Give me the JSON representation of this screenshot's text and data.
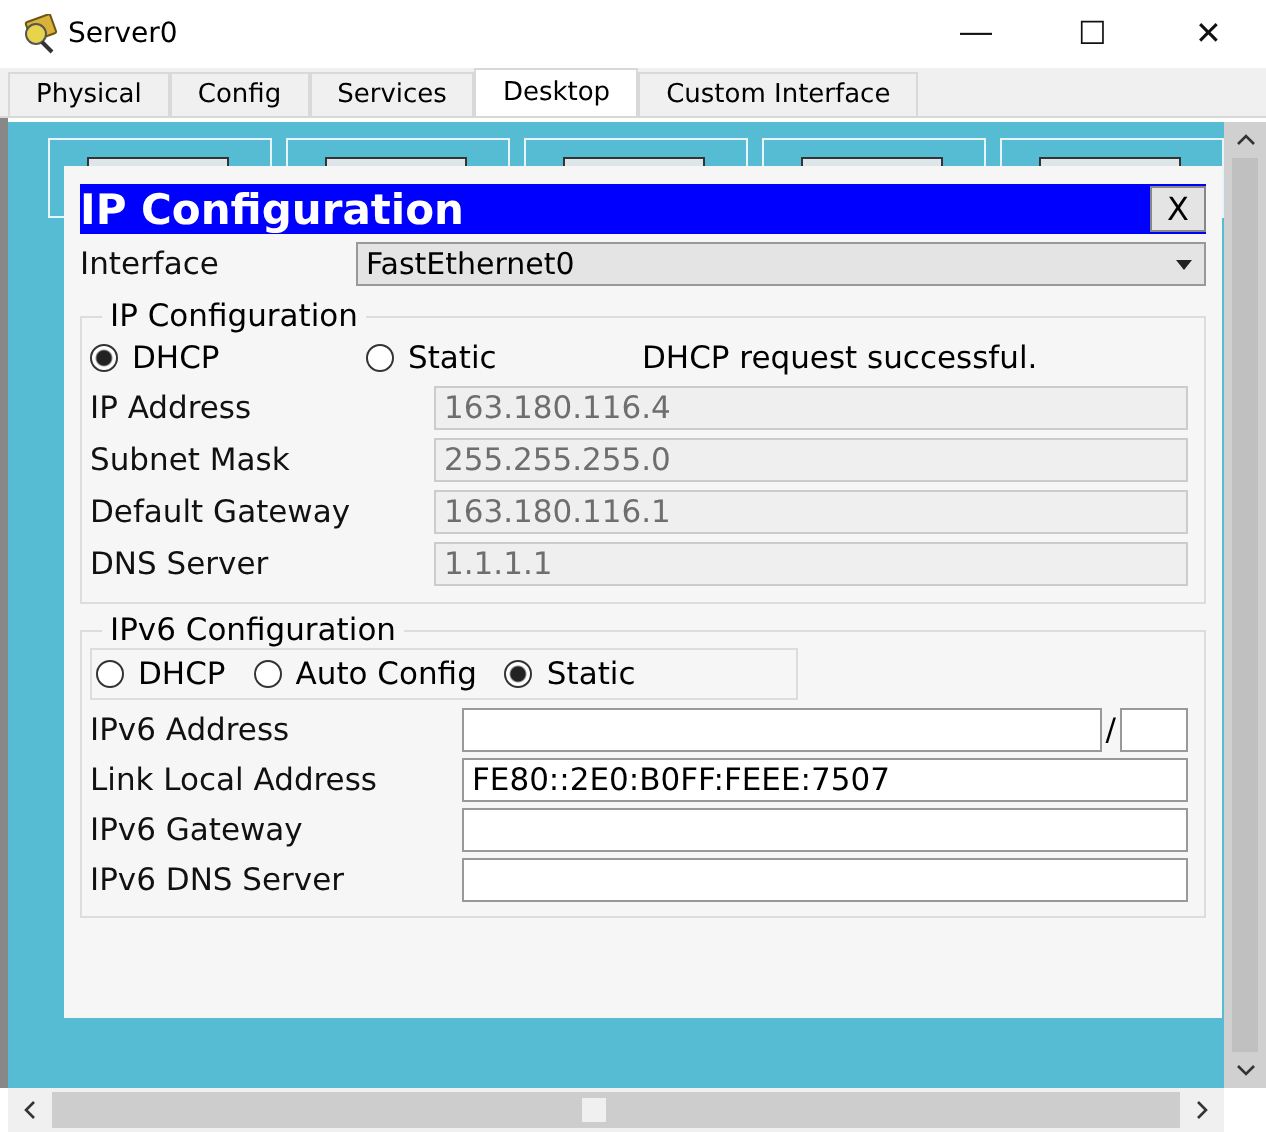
{
  "window": {
    "title": "Server0",
    "controls": [
      "—",
      "☐",
      "✕"
    ]
  },
  "tabs": [
    {
      "label": "Physical",
      "selected": false
    },
    {
      "label": "Config",
      "selected": false
    },
    {
      "label": "Services",
      "selected": false
    },
    {
      "label": "Desktop",
      "selected": true
    },
    {
      "label": "Custom Interface",
      "selected": false
    }
  ],
  "dialog": {
    "title": "IP Configuration",
    "close": "X",
    "interface": {
      "label": "Interface",
      "value": "FastEthernet0"
    },
    "ip_config": {
      "legend": "IP Configuration",
      "status": "DHCP request successful.",
      "modes": [
        {
          "label": "DHCP",
          "selected": true
        },
        {
          "label": "Static",
          "selected": false
        }
      ],
      "fields": [
        {
          "label": "IP Address",
          "value": "163.180.116.4",
          "disabled": true
        },
        {
          "label": "Subnet Mask",
          "value": "255.255.255.0",
          "disabled": true
        },
        {
          "label": "Default Gateway",
          "value": "163.180.116.1",
          "disabled": true
        },
        {
          "label": "DNS Server",
          "value": "1.1.1.1",
          "disabled": true
        }
      ]
    },
    "ipv6_config": {
      "legend": "IPv6 Configuration",
      "modes": [
        {
          "label": "DHCP",
          "selected": false
        },
        {
          "label": "Auto Config",
          "selected": false
        },
        {
          "label": "Static",
          "selected": true
        }
      ],
      "fields": [
        {
          "label": "IPv6 Address",
          "separator": "/",
          "disabled": false
        },
        {
          "label": "Link Local Address",
          "value": "FE80::2E0:B0FF:FEEE:7507",
          "disabled": false
        },
        {
          "label": "IPv6 Gateway",
          "disabled": false
        },
        {
          "label": "IPv6 DNS Server",
          "disabled": false
        }
      ]
    }
  }
}
